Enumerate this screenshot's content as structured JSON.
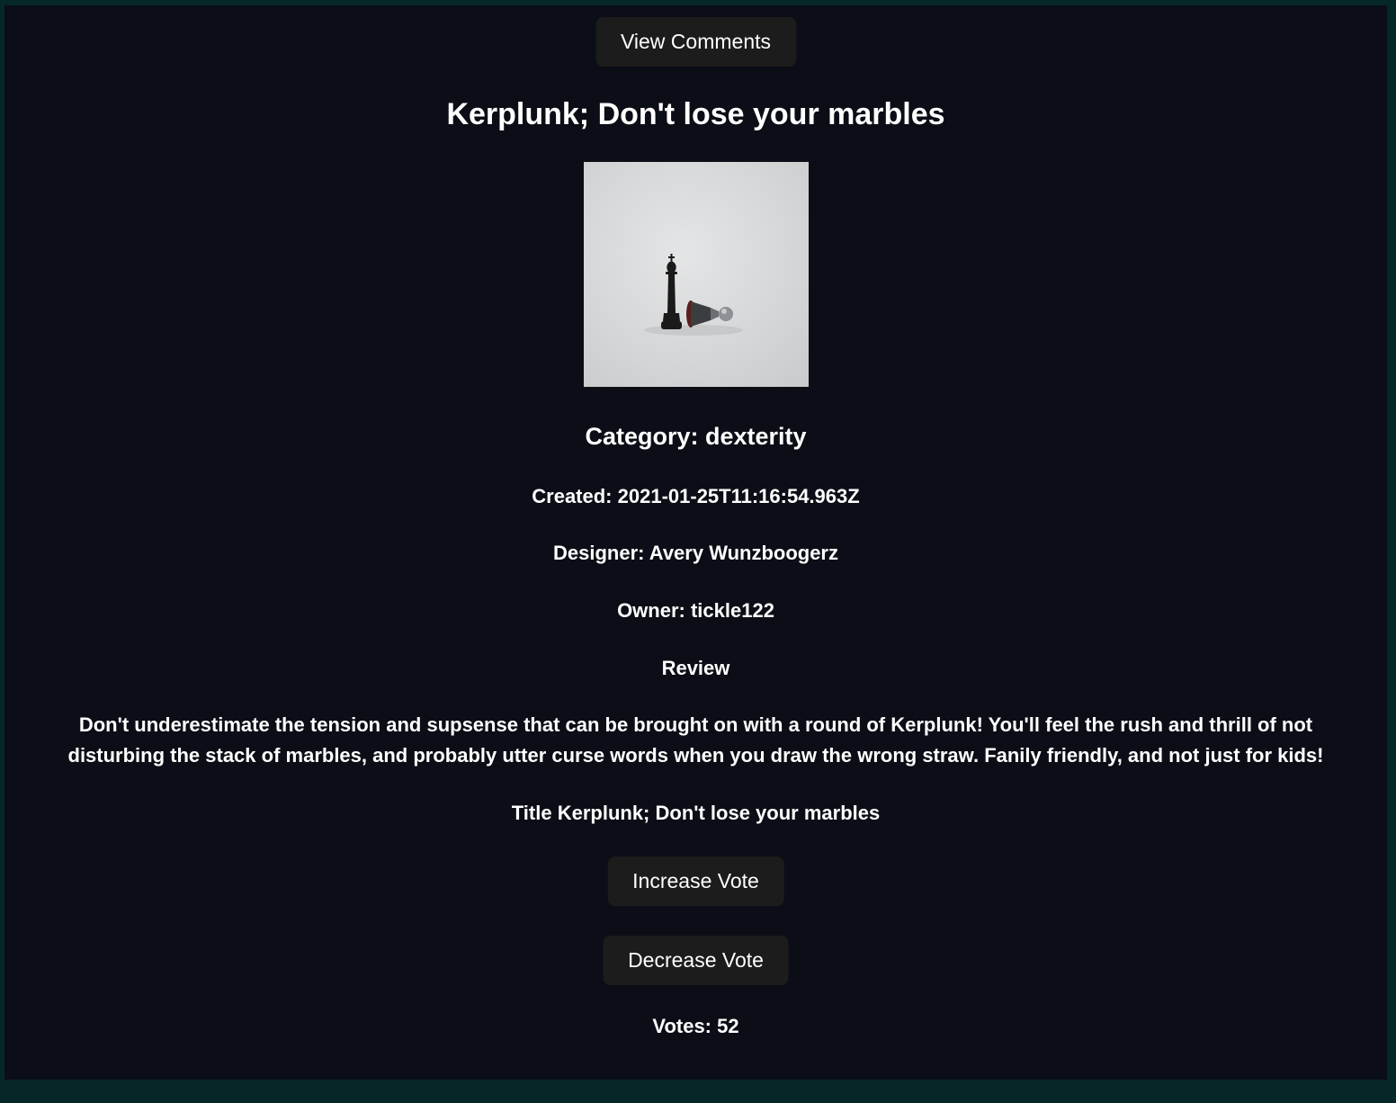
{
  "review": {
    "view_comments_label": "View Comments",
    "title": "Kerplunk; Don't lose your marbles",
    "image_alt": "Chess king and fallen pawn on a light grey background",
    "category": "Category: dexterity",
    "created": "Created: 2021-01-25T11:16:54.963Z",
    "designer": "Designer: Avery Wunzboogerz",
    "owner": "Owner: tickle122",
    "review_heading": "Review",
    "review_body": "Don't underestimate the tension and supsense that can be brought on with a round of Kerplunk! You'll feel the rush and thrill of not disturbing the stack of marbles, and probably utter curse words when you draw the wrong straw. Fanily friendly, and not just for kids!",
    "title_line": "Title Kerplunk; Don't lose your marbles",
    "increase_vote_label": "Increase Vote",
    "decrease_vote_label": "Decrease Vote",
    "votes": "Votes: 52"
  },
  "colors": {
    "page_border": "#062727",
    "panel_background": "#0b0e16",
    "button_background": "#1c1c1c",
    "text": "#ffffff"
  }
}
